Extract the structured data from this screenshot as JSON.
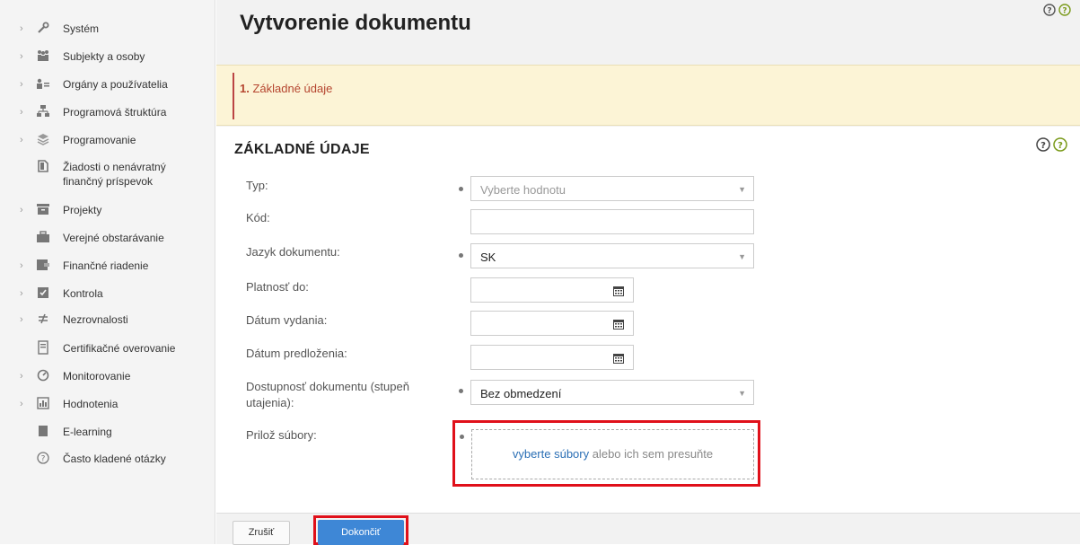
{
  "sidebar": {
    "items": [
      {
        "label": "Systém",
        "icon": "wrench-icon",
        "expandable": true
      },
      {
        "label": "Subjekty a osoby",
        "icon": "people-icon",
        "expandable": true
      },
      {
        "label": "Orgány a používatelia",
        "icon": "users-list-icon",
        "expandable": true
      },
      {
        "label": "Programová štruktúra",
        "icon": "hierarchy-icon",
        "expandable": true
      },
      {
        "label": "Programovanie",
        "icon": "layers-icon",
        "expandable": true
      },
      {
        "label": "Žiadosti o nenávratný finančný príspevok",
        "icon": "document-icon",
        "expandable": false
      },
      {
        "label": "Projekty",
        "icon": "archive-icon",
        "expandable": true
      },
      {
        "label": "Verejné obstarávanie",
        "icon": "briefcase-icon",
        "expandable": false
      },
      {
        "label": "Finančné riadenie",
        "icon": "finance-icon",
        "expandable": true
      },
      {
        "label": "Kontrola",
        "icon": "checkbox-icon",
        "expandable": true
      },
      {
        "label": "Nezrovnalosti",
        "icon": "not-equal-icon",
        "expandable": true
      },
      {
        "label": "Certifikačné overovanie",
        "icon": "certificate-icon",
        "expandable": false
      },
      {
        "label": "Monitorovanie",
        "icon": "gauge-icon",
        "expandable": true
      },
      {
        "label": "Hodnotenia",
        "icon": "bar-chart-icon",
        "expandable": true
      },
      {
        "label": "E-learning",
        "icon": "book-icon",
        "expandable": false
      },
      {
        "label": "Často kladené otázky",
        "icon": "question-circle-icon",
        "expandable": false
      }
    ]
  },
  "header": {
    "title": "Vytvorenie dokumentu"
  },
  "steps": {
    "current_number": "1.",
    "current_label": "Základné údaje"
  },
  "form": {
    "section_title": "ZÁKLADNÉ ÚDAJE",
    "typ": {
      "label": "Typ:",
      "placeholder": "Vyberte hodnotu"
    },
    "kod": {
      "label": "Kód:",
      "value": ""
    },
    "jazyk": {
      "label": "Jazyk dokumentu:",
      "value": "SK"
    },
    "platnost": {
      "label": "Platnosť do:",
      "value": ""
    },
    "datum_vydania": {
      "label": "Dátum vydania:",
      "value": ""
    },
    "datum_predlozenia": {
      "label": "Dátum predloženia:",
      "value": ""
    },
    "dostupnost": {
      "label": "Dostupnosť dokumentu (stupeň utajenia):",
      "value": "Bez obmedzení"
    },
    "subory": {
      "label": "Prilož súbory:",
      "link_text": "vyberte súbory",
      "rest_text": " alebo ich sem presuňte"
    }
  },
  "footer": {
    "cancel_label": "Zrušiť",
    "finish_label": "Dokončiť"
  },
  "colors": {
    "accent_blue": "#3e87d6",
    "highlight_red": "#e0101a",
    "step_bg": "#fcf4d6",
    "step_text": "#b5452f"
  }
}
